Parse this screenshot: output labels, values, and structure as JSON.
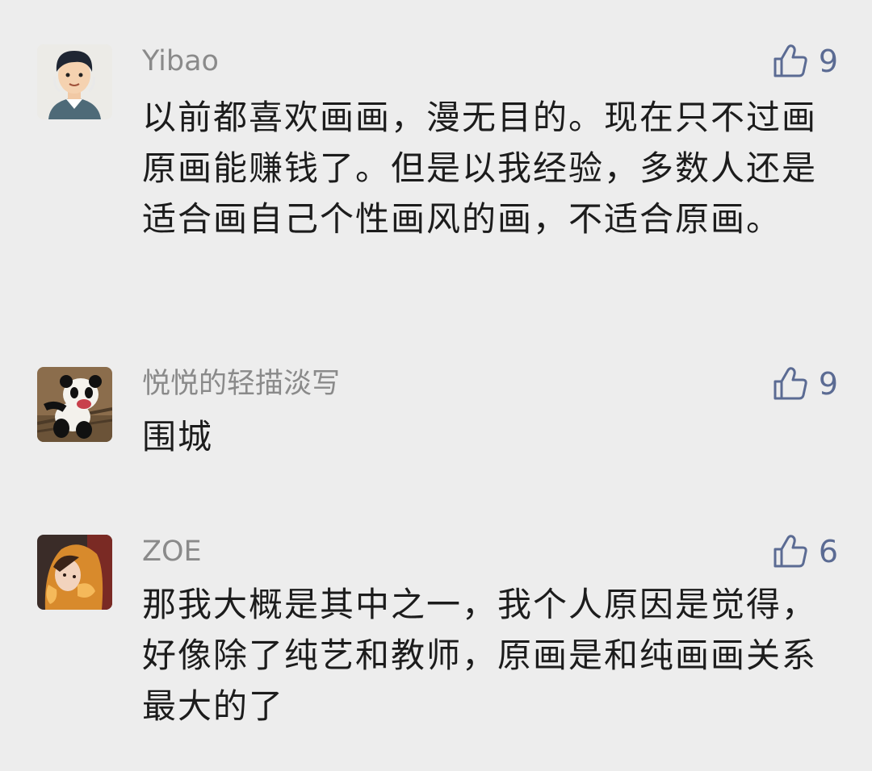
{
  "comments": [
    {
      "user": "Yibao",
      "likes": "9",
      "text": "以前都喜欢画画，漫无目的。现在只不过画原画能赚钱了。但是以我经验，多数人还是适合画自己个性画风的画，不适合原画。"
    },
    {
      "user": "悦悦的轻描淡写",
      "likes": "9",
      "text": "围城"
    },
    {
      "user": "ZOE",
      "likes": "6",
      "text": "那我大概是其中之一，我个人原因是觉得，好像除了纯艺和教师，原画是和纯画画关系最大的了"
    }
  ],
  "icons": {
    "like": "thumbs-up-outline-icon"
  },
  "colors": {
    "background": "#ededed",
    "username": "#8a8a8a",
    "like_accent": "#5b6b93",
    "text": "#1c1c1c"
  }
}
